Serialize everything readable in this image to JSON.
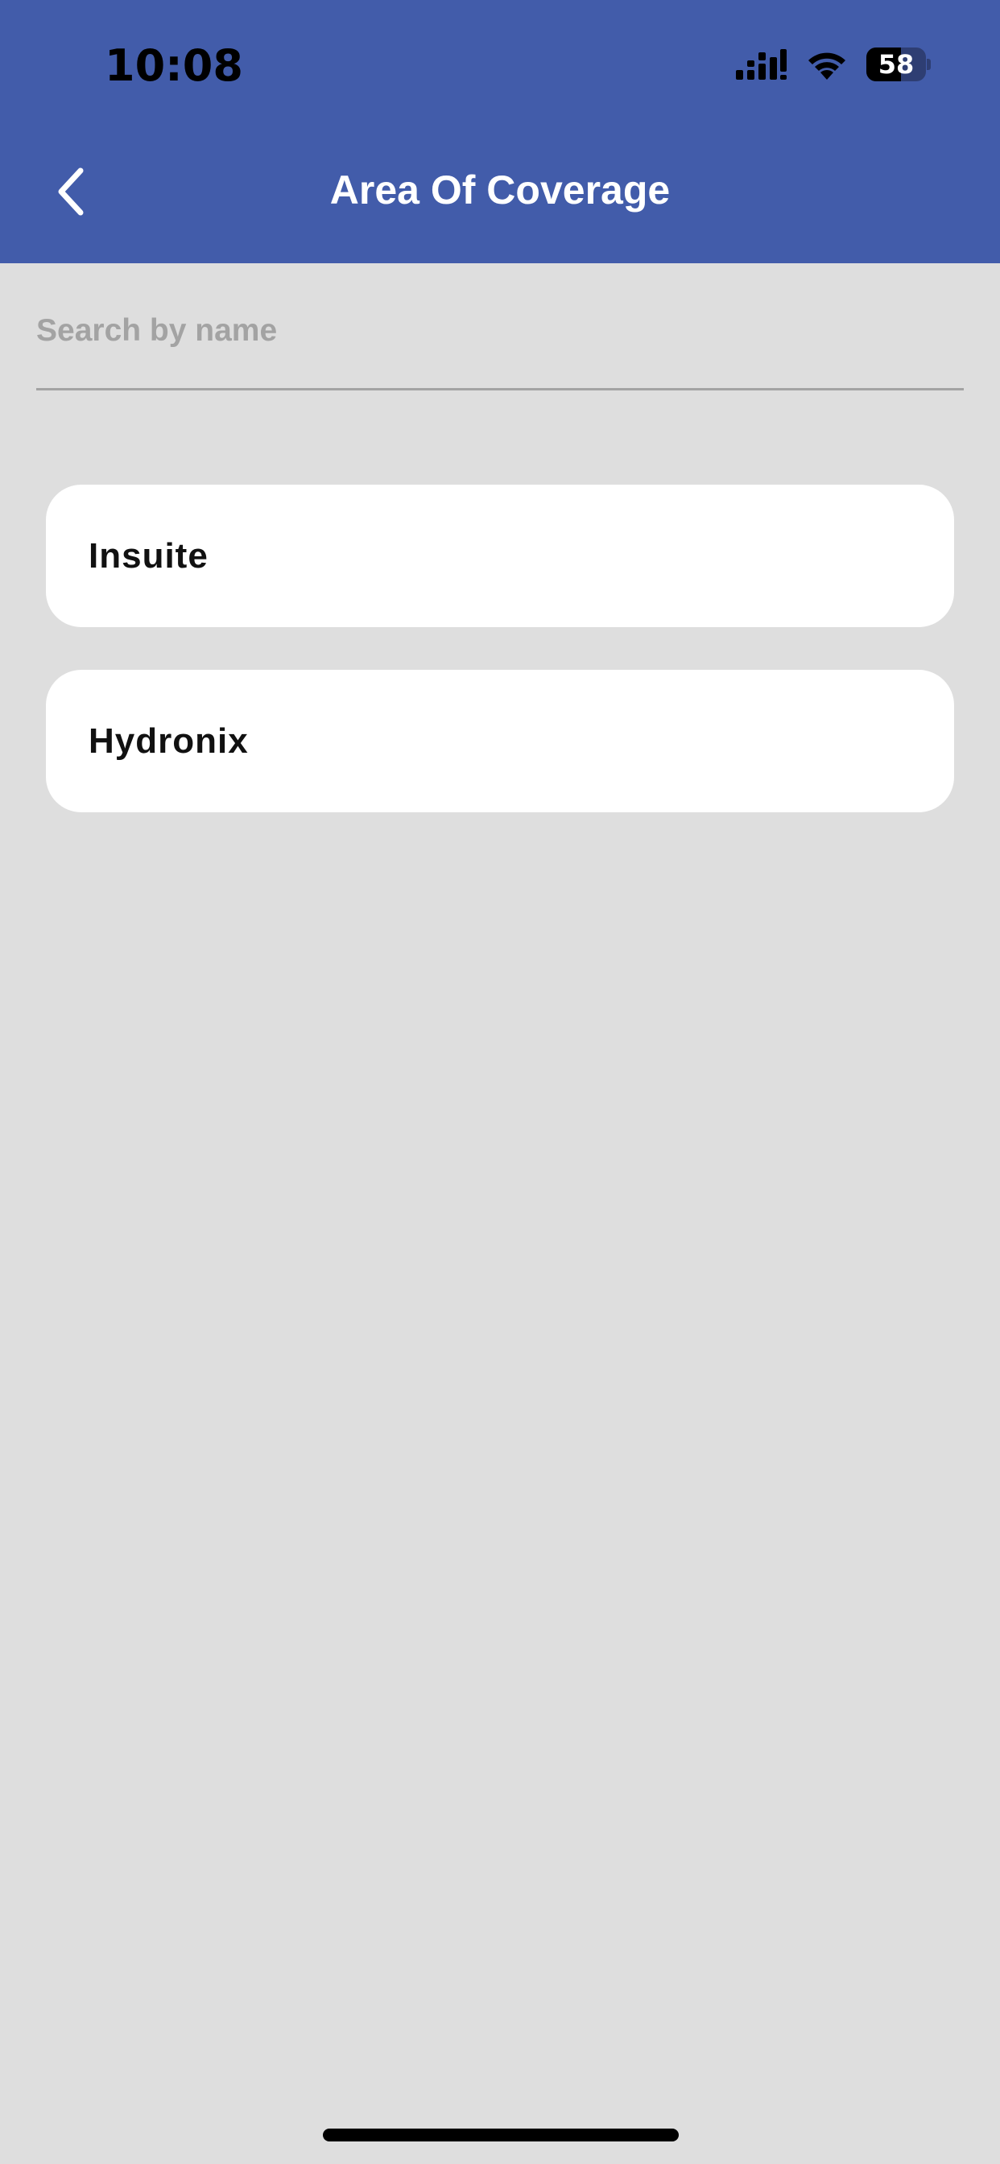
{
  "status_bar": {
    "time": "10:08",
    "battery_text": "58",
    "battery_level": 0.58,
    "icons": [
      "cellular-signal-icon",
      "wifi-icon",
      "battery-icon"
    ]
  },
  "header": {
    "title": "Area Of Coverage",
    "back_icon": "chevron-left-icon",
    "background_color": "#425CAA"
  },
  "search": {
    "value": "",
    "placeholder": "Search by name"
  },
  "list": {
    "items": [
      {
        "label": "Insuite"
      },
      {
        "label": "Hydronix"
      }
    ]
  },
  "colors": {
    "background": "#DEDEDE",
    "card": "#FFFFFF",
    "accent": "#425CAA"
  }
}
